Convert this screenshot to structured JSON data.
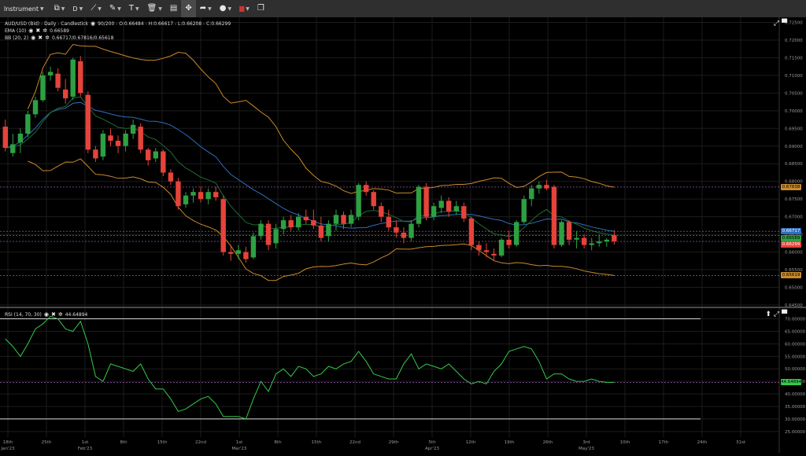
{
  "toolbar": {
    "instrument_label": "Instrument",
    "timeframe_label": "D",
    "icons": [
      "bar-style-icon",
      "line-tool-icon",
      "pencil-icon",
      "text-icon",
      "trash-icon",
      "layout-icon",
      "crosshair-icon",
      "share-icon",
      "theme-icon",
      "flag-icon",
      "window-icon"
    ]
  },
  "legend": {
    "main": "AUD/USD (Bid) - Daily - Candlestick",
    "main_values": "90/200 - O:0.66484 - H:0.66617 - L:0.66208 - C:0.66299",
    "ema_label": "EMA (10)",
    "ema_value": "0.66589",
    "bb_label": "BB (20, 2)",
    "bb_value": "0.66717/0.67816/0.65618",
    "rsi_label": "RSI (14, 70, 30)",
    "rsi_value": "44.64894"
  },
  "price_axis": [
    "0.72500",
    "0.72000",
    "0.71500",
    "0.71000",
    "0.70500",
    "0.70000",
    "0.69500",
    "0.69000",
    "0.68500",
    "0.68000",
    "0.67500",
    "0.67000",
    "0.66500",
    "0.66000",
    "0.65500",
    "0.65000",
    "0.64500"
  ],
  "rsi_axis": [
    "70.00000",
    "65.00000",
    "60.00000",
    "55.00000",
    "50.00000",
    "45.00000",
    "40.00000",
    "35.00000",
    "30.00000",
    "25.00000"
  ],
  "price_tags": {
    "bb_upper": "0.67838",
    "bb_mid": "0.66717",
    "ema": "0.66589",
    "close": "0.66299",
    "bb_lower": "0.65619",
    "rsi": "44.64894"
  },
  "time_axis": [
    {
      "label": "18th",
      "sub": "Jan'23"
    },
    {
      "label": "25th",
      "sub": ""
    },
    {
      "label": "1st",
      "sub": "Feb'23"
    },
    {
      "label": "8th",
      "sub": ""
    },
    {
      "label": "15th",
      "sub": ""
    },
    {
      "label": "22nd",
      "sub": ""
    },
    {
      "label": "1st",
      "sub": "Mar'23"
    },
    {
      "label": "8th",
      "sub": ""
    },
    {
      "label": "15th",
      "sub": ""
    },
    {
      "label": "22nd",
      "sub": ""
    },
    {
      "label": "29th",
      "sub": ""
    },
    {
      "label": "5th",
      "sub": "Apr'23"
    },
    {
      "label": "12th",
      "sub": ""
    },
    {
      "label": "19th",
      "sub": ""
    },
    {
      "label": "26th",
      "sub": ""
    },
    {
      "label": "3rd",
      "sub": "May'23"
    },
    {
      "label": "10th",
      "sub": ""
    },
    {
      "label": "17th",
      "sub": ""
    },
    {
      "label": "24th",
      "sub": ""
    },
    {
      "label": "31st",
      "sub": ""
    }
  ],
  "colors": {
    "bull": "#2ea043",
    "bear": "#e5433b",
    "ema": "#1f6b2f",
    "bb_mid": "#2f6ebd",
    "bb_band": "#c98a2c",
    "rsi": "#35c94a",
    "grid": "#1c1c1c"
  },
  "chart_data": {
    "type": "candlestick",
    "candles": [
      {
        "o": 0.6955,
        "h": 0.6975,
        "l": 0.6885,
        "c": 0.6895
      },
      {
        "o": 0.688,
        "h": 0.6935,
        "l": 0.687,
        "c": 0.6905
      },
      {
        "o": 0.691,
        "h": 0.695,
        "l": 0.688,
        "c": 0.6935
      },
      {
        "o": 0.6935,
        "h": 0.7,
        "l": 0.6925,
        "c": 0.699
      },
      {
        "o": 0.699,
        "h": 0.704,
        "l": 0.698,
        "c": 0.703
      },
      {
        "o": 0.703,
        "h": 0.711,
        "l": 0.7025,
        "c": 0.71
      },
      {
        "o": 0.71,
        "h": 0.7125,
        "l": 0.7085,
        "c": 0.711
      },
      {
        "o": 0.7105,
        "h": 0.712,
        "l": 0.7055,
        "c": 0.7065
      },
      {
        "o": 0.706,
        "h": 0.709,
        "l": 0.702,
        "c": 0.7035
      },
      {
        "o": 0.704,
        "h": 0.715,
        "l": 0.703,
        "c": 0.7145
      },
      {
        "o": 0.714,
        "h": 0.7155,
        "l": 0.704,
        "c": 0.705
      },
      {
        "o": 0.7045,
        "h": 0.7055,
        "l": 0.688,
        "c": 0.689
      },
      {
        "o": 0.689,
        "h": 0.69,
        "l": 0.6855,
        "c": 0.6865
      },
      {
        "o": 0.687,
        "h": 0.6945,
        "l": 0.686,
        "c": 0.6935
      },
      {
        "o": 0.693,
        "h": 0.695,
        "l": 0.69,
        "c": 0.6915
      },
      {
        "o": 0.6915,
        "h": 0.693,
        "l": 0.688,
        "c": 0.69
      },
      {
        "o": 0.69,
        "h": 0.6945,
        "l": 0.6885,
        "c": 0.6935
      },
      {
        "o": 0.6935,
        "h": 0.6975,
        "l": 0.692,
        "c": 0.696
      },
      {
        "o": 0.6955,
        "h": 0.6965,
        "l": 0.688,
        "c": 0.689
      },
      {
        "o": 0.689,
        "h": 0.6895,
        "l": 0.6845,
        "c": 0.686
      },
      {
        "o": 0.6865,
        "h": 0.6895,
        "l": 0.6855,
        "c": 0.6885
      },
      {
        "o": 0.6885,
        "h": 0.689,
        "l": 0.6815,
        "c": 0.6825
      },
      {
        "o": 0.6825,
        "h": 0.6835,
        "l": 0.679,
        "c": 0.68
      },
      {
        "o": 0.68,
        "h": 0.681,
        "l": 0.672,
        "c": 0.673
      },
      {
        "o": 0.6735,
        "h": 0.677,
        "l": 0.6725,
        "c": 0.676
      },
      {
        "o": 0.676,
        "h": 0.678,
        "l": 0.674,
        "c": 0.677
      },
      {
        "o": 0.677,
        "h": 0.6785,
        "l": 0.674,
        "c": 0.675
      },
      {
        "o": 0.675,
        "h": 0.678,
        "l": 0.6735,
        "c": 0.677
      },
      {
        "o": 0.677,
        "h": 0.6785,
        "l": 0.6745,
        "c": 0.6755
      },
      {
        "o": 0.675,
        "h": 0.676,
        "l": 0.659,
        "c": 0.66
      },
      {
        "o": 0.66,
        "h": 0.662,
        "l": 0.6575,
        "c": 0.6595
      },
      {
        "o": 0.6595,
        "h": 0.662,
        "l": 0.658,
        "c": 0.6605
      },
      {
        "o": 0.66,
        "h": 0.6615,
        "l": 0.657,
        "c": 0.658
      },
      {
        "o": 0.6585,
        "h": 0.6655,
        "l": 0.658,
        "c": 0.6645
      },
      {
        "o": 0.6645,
        "h": 0.669,
        "l": 0.6635,
        "c": 0.668
      },
      {
        "o": 0.668,
        "h": 0.669,
        "l": 0.6605,
        "c": 0.662
      },
      {
        "o": 0.6625,
        "h": 0.668,
        "l": 0.661,
        "c": 0.6665
      },
      {
        "o": 0.6665,
        "h": 0.67,
        "l": 0.665,
        "c": 0.669
      },
      {
        "o": 0.669,
        "h": 0.6705,
        "l": 0.666,
        "c": 0.667
      },
      {
        "o": 0.667,
        "h": 0.671,
        "l": 0.666,
        "c": 0.67
      },
      {
        "o": 0.67,
        "h": 0.672,
        "l": 0.668,
        "c": 0.669
      },
      {
        "o": 0.669,
        "h": 0.672,
        "l": 0.6665,
        "c": 0.6675
      },
      {
        "o": 0.6675,
        "h": 0.67,
        "l": 0.663,
        "c": 0.664
      },
      {
        "o": 0.6645,
        "h": 0.669,
        "l": 0.663,
        "c": 0.668
      },
      {
        "o": 0.668,
        "h": 0.672,
        "l": 0.666,
        "c": 0.6705
      },
      {
        "o": 0.6705,
        "h": 0.6715,
        "l": 0.6665,
        "c": 0.668
      },
      {
        "o": 0.668,
        "h": 0.672,
        "l": 0.667,
        "c": 0.6705
      },
      {
        "o": 0.67,
        "h": 0.6795,
        "l": 0.669,
        "c": 0.679
      },
      {
        "o": 0.679,
        "h": 0.68,
        "l": 0.676,
        "c": 0.677
      },
      {
        "o": 0.677,
        "h": 0.6775,
        "l": 0.672,
        "c": 0.673
      },
      {
        "o": 0.673,
        "h": 0.674,
        "l": 0.6685,
        "c": 0.67
      },
      {
        "o": 0.67,
        "h": 0.672,
        "l": 0.666,
        "c": 0.667
      },
      {
        "o": 0.667,
        "h": 0.669,
        "l": 0.664,
        "c": 0.6655
      },
      {
        "o": 0.6655,
        "h": 0.667,
        "l": 0.6625,
        "c": 0.664
      },
      {
        "o": 0.664,
        "h": 0.669,
        "l": 0.663,
        "c": 0.668
      },
      {
        "o": 0.668,
        "h": 0.679,
        "l": 0.667,
        "c": 0.6785
      },
      {
        "o": 0.6785,
        "h": 0.6795,
        "l": 0.669,
        "c": 0.67
      },
      {
        "o": 0.67,
        "h": 0.674,
        "l": 0.669,
        "c": 0.673
      },
      {
        "o": 0.6725,
        "h": 0.676,
        "l": 0.671,
        "c": 0.6745
      },
      {
        "o": 0.6745,
        "h": 0.6755,
        "l": 0.67,
        "c": 0.6715
      },
      {
        "o": 0.6715,
        "h": 0.6745,
        "l": 0.6705,
        "c": 0.673
      },
      {
        "o": 0.673,
        "h": 0.674,
        "l": 0.6685,
        "c": 0.6695
      },
      {
        "o": 0.6695,
        "h": 0.67,
        "l": 0.6605,
        "c": 0.662
      },
      {
        "o": 0.662,
        "h": 0.663,
        "l": 0.659,
        "c": 0.6605
      },
      {
        "o": 0.6605,
        "h": 0.6625,
        "l": 0.6585,
        "c": 0.66
      },
      {
        "o": 0.6595,
        "h": 0.661,
        "l": 0.6575,
        "c": 0.659
      },
      {
        "o": 0.659,
        "h": 0.664,
        "l": 0.6585,
        "c": 0.6635
      },
      {
        "o": 0.6635,
        "h": 0.666,
        "l": 0.661,
        "c": 0.662
      },
      {
        "o": 0.662,
        "h": 0.669,
        "l": 0.6615,
        "c": 0.6685
      },
      {
        "o": 0.6685,
        "h": 0.676,
        "l": 0.668,
        "c": 0.675
      },
      {
        "o": 0.675,
        "h": 0.679,
        "l": 0.673,
        "c": 0.678
      },
      {
        "o": 0.678,
        "h": 0.68,
        "l": 0.6765,
        "c": 0.679
      },
      {
        "o": 0.679,
        "h": 0.6805,
        "l": 0.6775,
        "c": 0.678
      },
      {
        "o": 0.6785,
        "h": 0.679,
        "l": 0.661,
        "c": 0.662
      },
      {
        "o": 0.662,
        "h": 0.669,
        "l": 0.6615,
        "c": 0.6685
      },
      {
        "o": 0.6685,
        "h": 0.669,
        "l": 0.662,
        "c": 0.6635
      },
      {
        "o": 0.6635,
        "h": 0.666,
        "l": 0.661,
        "c": 0.664
      },
      {
        "o": 0.664,
        "h": 0.665,
        "l": 0.661,
        "c": 0.662
      },
      {
        "o": 0.662,
        "h": 0.664,
        "l": 0.6605,
        "c": 0.6625
      },
      {
        "o": 0.6625,
        "h": 0.665,
        "l": 0.6615,
        "c": 0.663
      },
      {
        "o": 0.663,
        "h": 0.664,
        "l": 0.6615,
        "c": 0.6635
      },
      {
        "o": 0.6648,
        "h": 0.6662,
        "l": 0.6621,
        "c": 0.663
      }
    ],
    "rsi": [
      62,
      59,
      55,
      60,
      66,
      68,
      71,
      70,
      66,
      65,
      69,
      60,
      47,
      45,
      52,
      51,
      50,
      49,
      52,
      46,
      42,
      42,
      38,
      33,
      34,
      36,
      38,
      39,
      36,
      31,
      31,
      31,
      30,
      38,
      45,
      41,
      48,
      50,
      47,
      51,
      50,
      47,
      48,
      51,
      50,
      52,
      53,
      57,
      53,
      48,
      47,
      46,
      46,
      52,
      56,
      50,
      52,
      51,
      50,
      52,
      49,
      46,
      44,
      45,
      44,
      49,
      52,
      57,
      58,
      59,
      58,
      53,
      46,
      48,
      48,
      46,
      45,
      45,
      46,
      45,
      44.6,
      44.6
    ],
    "price_ylim": [
      0.645,
      0.726
    ],
    "rsi_ylim": [
      24,
      73
    ],
    "rsi_levels": [
      70,
      30
    ]
  }
}
